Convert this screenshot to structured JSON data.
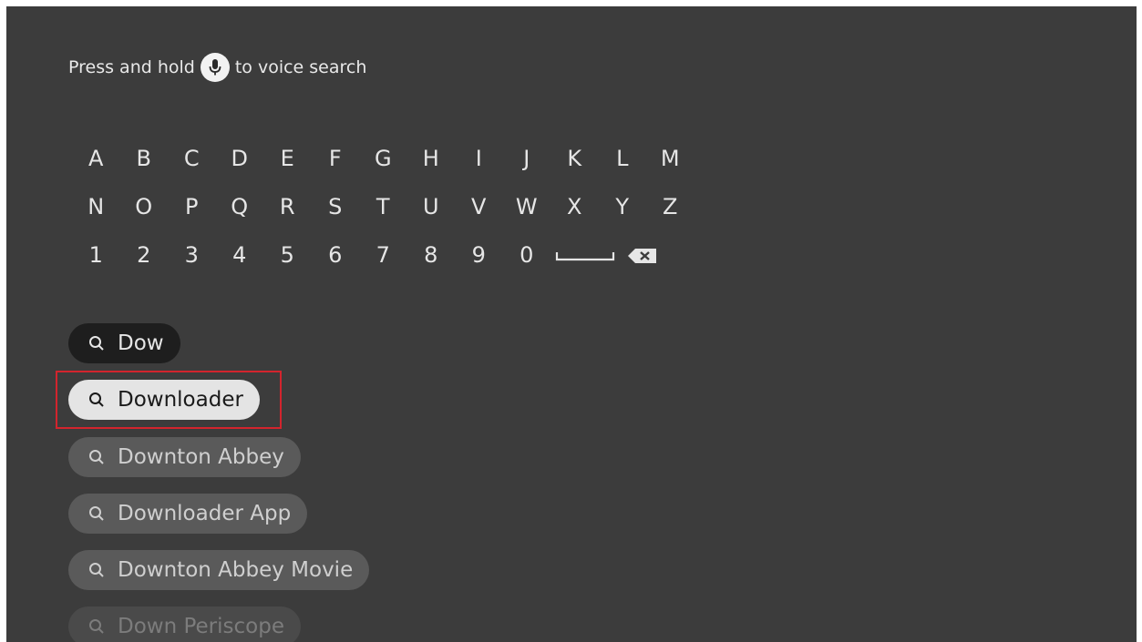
{
  "voice_hint": {
    "before": "Press and hold",
    "after": "to voice search"
  },
  "keyboard": {
    "row1": [
      "A",
      "B",
      "C",
      "D",
      "E",
      "F",
      "G",
      "H",
      "I",
      "J",
      "K",
      "L",
      "M"
    ],
    "row2": [
      "N",
      "O",
      "P",
      "Q",
      "R",
      "S",
      "T",
      "U",
      "V",
      "W",
      "X",
      "Y",
      "Z"
    ],
    "row3": [
      "1",
      "2",
      "3",
      "4",
      "5",
      "6",
      "7",
      "8",
      "9",
      "0"
    ]
  },
  "search": {
    "query": "Dow"
  },
  "suggestions": [
    "Downloader",
    "Downton Abbey",
    "Downloader App",
    "Downton Abbey Movie",
    "Down Periscope"
  ],
  "colors": {
    "background": "#3c3c3c",
    "highlight_border": "#d3242d",
    "selected_chip": "#e4e4e4"
  }
}
